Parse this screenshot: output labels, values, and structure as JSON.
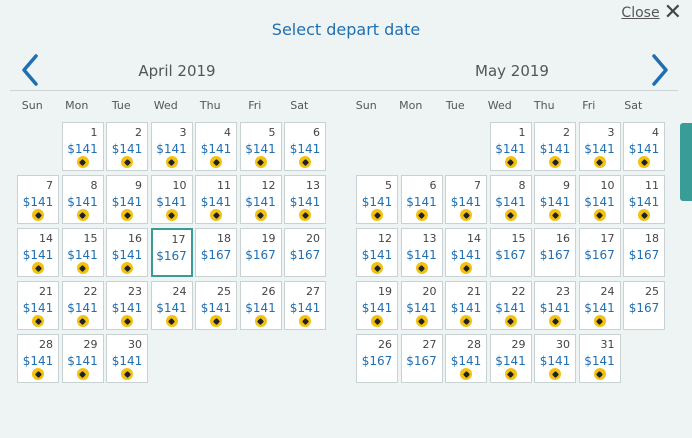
{
  "header": {
    "title": "Select depart date",
    "close_label": "Close",
    "close_icon": "close-icon",
    "prev_icon": "chevron-left-icon",
    "next_icon": "chevron-right-icon"
  },
  "colors": {
    "accent_blue": "#1f6fb2",
    "selected_border": "#3a9c96",
    "deal_tag": "#f3c112"
  },
  "calendars": [
    {
      "month_title": "April 2019",
      "weekdays": [
        "Sun",
        "Mon",
        "Tue",
        "Wed",
        "Thu",
        "Fri",
        "Sat"
      ],
      "first_weekday": 1,
      "days": [
        {
          "day": "1",
          "price": "$141",
          "tag": true
        },
        {
          "day": "2",
          "price": "$141",
          "tag": true
        },
        {
          "day": "3",
          "price": "$141",
          "tag": true
        },
        {
          "day": "4",
          "price": "$141",
          "tag": true
        },
        {
          "day": "5",
          "price": "$141",
          "tag": true
        },
        {
          "day": "6",
          "price": "$141",
          "tag": true
        },
        {
          "day": "7",
          "price": "$141",
          "tag": true
        },
        {
          "day": "8",
          "price": "$141",
          "tag": true
        },
        {
          "day": "9",
          "price": "$141",
          "tag": true
        },
        {
          "day": "10",
          "price": "$141",
          "tag": true
        },
        {
          "day": "11",
          "price": "$141",
          "tag": true
        },
        {
          "day": "12",
          "price": "$141",
          "tag": true
        },
        {
          "day": "13",
          "price": "$141",
          "tag": true
        },
        {
          "day": "14",
          "price": "$141",
          "tag": true
        },
        {
          "day": "15",
          "price": "$141",
          "tag": true
        },
        {
          "day": "16",
          "price": "$141",
          "tag": true
        },
        {
          "day": "17",
          "price": "$167",
          "tag": false,
          "selected": true
        },
        {
          "day": "18",
          "price": "$167",
          "tag": false
        },
        {
          "day": "19",
          "price": "$167",
          "tag": false
        },
        {
          "day": "20",
          "price": "$167",
          "tag": false
        },
        {
          "day": "21",
          "price": "$141",
          "tag": true
        },
        {
          "day": "22",
          "price": "$141",
          "tag": true
        },
        {
          "day": "23",
          "price": "$141",
          "tag": true
        },
        {
          "day": "24",
          "price": "$141",
          "tag": true
        },
        {
          "day": "25",
          "price": "$141",
          "tag": true
        },
        {
          "day": "26",
          "price": "$141",
          "tag": true
        },
        {
          "day": "27",
          "price": "$141",
          "tag": true
        },
        {
          "day": "28",
          "price": "$141",
          "tag": true
        },
        {
          "day": "29",
          "price": "$141",
          "tag": true
        },
        {
          "day": "30",
          "price": "$141",
          "tag": true
        }
      ]
    },
    {
      "month_title": "May 2019",
      "weekdays": [
        "Sun",
        "Mon",
        "Tue",
        "Wed",
        "Thu",
        "Fri",
        "Sat"
      ],
      "first_weekday": 3,
      "days": [
        {
          "day": "1",
          "price": "$141",
          "tag": true
        },
        {
          "day": "2",
          "price": "$141",
          "tag": true
        },
        {
          "day": "3",
          "price": "$141",
          "tag": true
        },
        {
          "day": "4",
          "price": "$141",
          "tag": true
        },
        {
          "day": "5",
          "price": "$141",
          "tag": true
        },
        {
          "day": "6",
          "price": "$141",
          "tag": true
        },
        {
          "day": "7",
          "price": "$141",
          "tag": true
        },
        {
          "day": "8",
          "price": "$141",
          "tag": true
        },
        {
          "day": "9",
          "price": "$141",
          "tag": true
        },
        {
          "day": "10",
          "price": "$141",
          "tag": true
        },
        {
          "day": "11",
          "price": "$141",
          "tag": true
        },
        {
          "day": "12",
          "price": "$141",
          "tag": true
        },
        {
          "day": "13",
          "price": "$141",
          "tag": true
        },
        {
          "day": "14",
          "price": "$141",
          "tag": true
        },
        {
          "day": "15",
          "price": "$167",
          "tag": false
        },
        {
          "day": "16",
          "price": "$167",
          "tag": false
        },
        {
          "day": "17",
          "price": "$167",
          "tag": false
        },
        {
          "day": "18",
          "price": "$167",
          "tag": false
        },
        {
          "day": "19",
          "price": "$141",
          "tag": true
        },
        {
          "day": "20",
          "price": "$141",
          "tag": true
        },
        {
          "day": "21",
          "price": "$141",
          "tag": true
        },
        {
          "day": "22",
          "price": "$141",
          "tag": true
        },
        {
          "day": "23",
          "price": "$141",
          "tag": true
        },
        {
          "day": "24",
          "price": "$141",
          "tag": true
        },
        {
          "day": "25",
          "price": "$167",
          "tag": false
        },
        {
          "day": "26",
          "price": "$167",
          "tag": false
        },
        {
          "day": "27",
          "price": "$167",
          "tag": false
        },
        {
          "day": "28",
          "price": "$141",
          "tag": true
        },
        {
          "day": "29",
          "price": "$141",
          "tag": true
        },
        {
          "day": "30",
          "price": "$141",
          "tag": true
        },
        {
          "day": "31",
          "price": "$141",
          "tag": true
        }
      ]
    }
  ]
}
